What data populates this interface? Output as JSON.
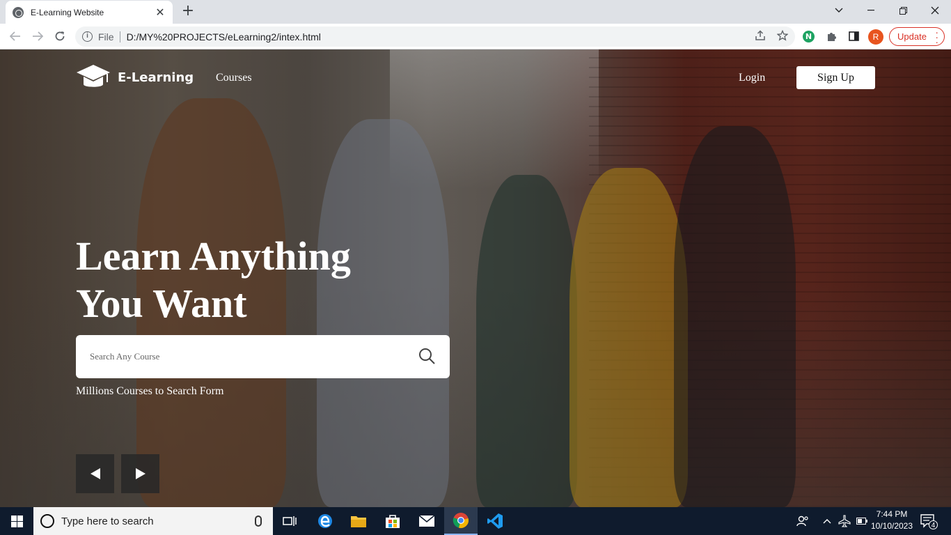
{
  "browser": {
    "tab_title": "E-Learning Website",
    "url_scheme": "File",
    "url": "D:/MY%20PROJECTS/eLearning2/intex.html",
    "profile_initial": "R",
    "extension_initial": "N",
    "update_label": "Update"
  },
  "site": {
    "brand": "E-Learning",
    "nav": {
      "courses": "Courses",
      "login": "Login",
      "signup": "Sign Up"
    },
    "hero": {
      "headline_line1": "Learn Anything",
      "headline_line2": "You Want",
      "search_placeholder": "Search Any Course",
      "tagline": "Millions Courses to Search Form"
    }
  },
  "taskbar": {
    "search_placeholder": "Type here to search",
    "time": "7:44 PM",
    "date": "10/10/2023",
    "notification_count": "4"
  },
  "colors": {
    "update_red": "#d93025",
    "profile_orange": "#e8541e",
    "taskbar_bg": "#0f1b2d"
  }
}
